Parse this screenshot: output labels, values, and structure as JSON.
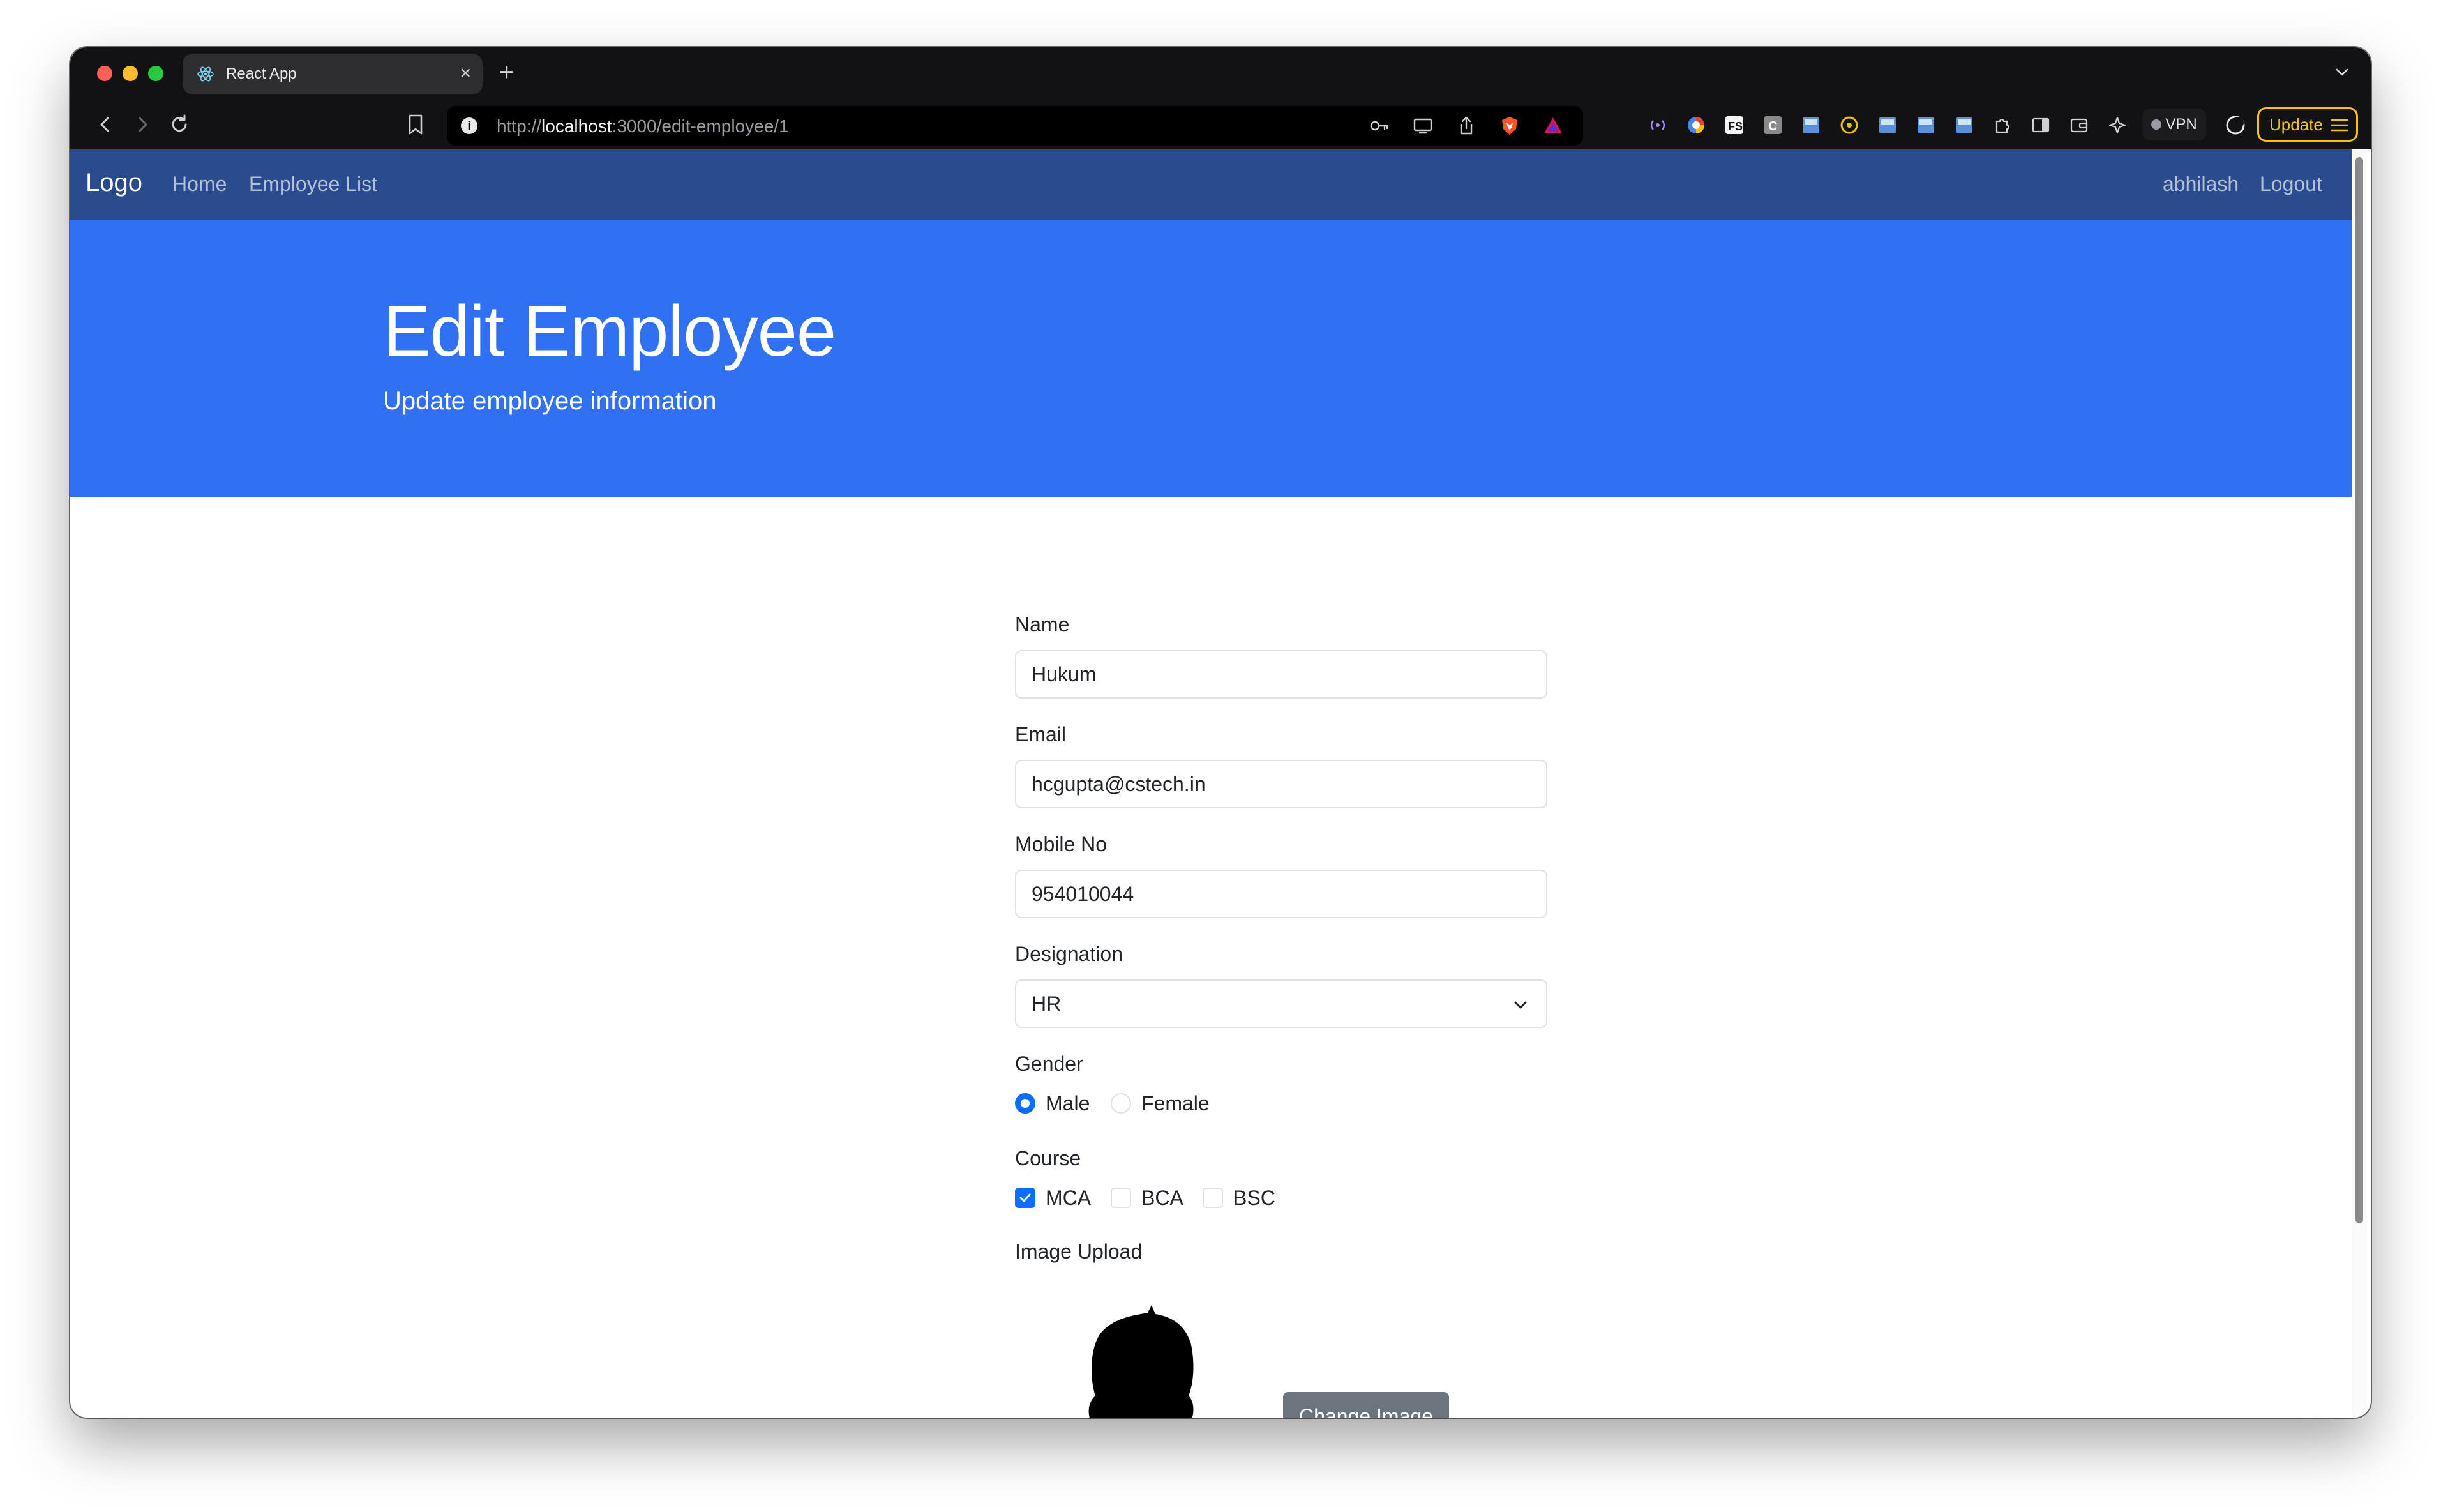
{
  "browser": {
    "tab_title": "React App",
    "tab_close": "×",
    "new_tab": "+",
    "url_prefix": "http://",
    "url_host": "localhost",
    "url_path": ":3000/edit-employee/1",
    "vpn_label": "VPN",
    "update_label": "Update"
  },
  "navbar": {
    "brand": "Logo",
    "links": [
      "Home",
      "Employee List"
    ],
    "user": "abhilash",
    "logout": "Logout"
  },
  "hero": {
    "title": "Edit Employee",
    "subtitle": "Update employee information"
  },
  "form": {
    "name_label": "Name",
    "name_value": "Hukum",
    "email_label": "Email",
    "email_value": "hcgupta@cstech.in",
    "mobile_label": "Mobile No",
    "mobile_value": "954010044",
    "designation_label": "Designation",
    "designation_value": "HR",
    "gender_label": "Gender",
    "gender_options": [
      "Male",
      "Female"
    ],
    "gender_selected": "Male",
    "course_label": "Course",
    "course_options": [
      "MCA",
      "BCA",
      "BSC"
    ],
    "course_checked": [
      "MCA"
    ],
    "image_label": "Image Upload",
    "change_image": "Change Image"
  },
  "colors": {
    "navbar": "#2a4c8f",
    "hero": "#3270f2",
    "accent": "#0d6efd",
    "secondary_button": "#6c757d"
  }
}
